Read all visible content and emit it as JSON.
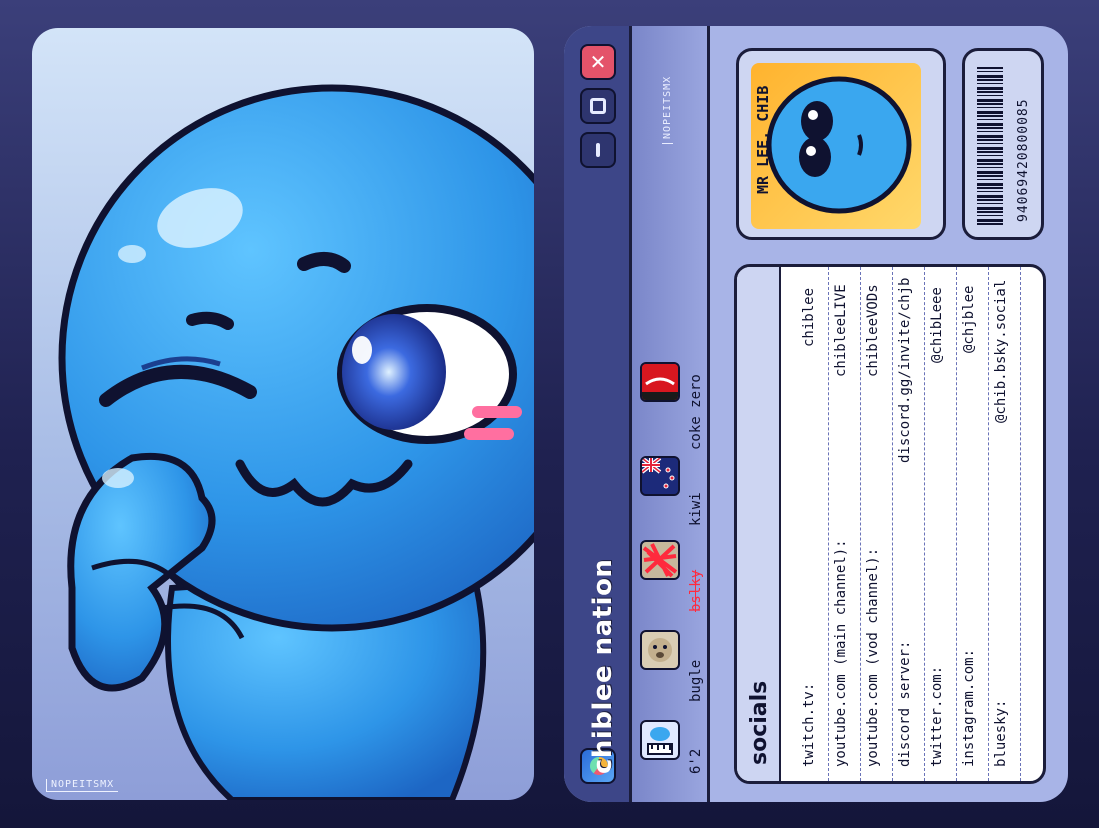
{
  "art": {
    "watermark": "NOPEITSMX"
  },
  "window": {
    "close_label": "✕",
    "app_title": "chiblee nation",
    "watermark": "NOPEITSMX"
  },
  "stats": [
    {
      "icon": "height-ruler-icon",
      "label": "6'2"
    },
    {
      "icon": "bugle-icon",
      "label": "bugle"
    },
    {
      "icon": "crossed-out-icon",
      "label": "bslky"
    },
    {
      "icon": "nz-flag-icon",
      "label": "kiwi"
    },
    {
      "icon": "coke-can-icon",
      "label": "coke zero"
    }
  ],
  "id": {
    "name": "MR LEE, CHIB",
    "barcode_number": "94069420800085"
  },
  "socials": {
    "title": "socials",
    "rows": [
      {
        "key": "twitch.tv:",
        "value": "chiblee"
      },
      {
        "key": "youtube.com (main channel):",
        "value": "chibleeLIVE"
      },
      {
        "key": "youtube.com (vod channel):",
        "value": "chibleeVODs"
      },
      {
        "key": "discord server:",
        "value": "discord.gg/invite/chjb"
      },
      {
        "key": "twitter.com:",
        "value": "@chibLeee"
      },
      {
        "key": "instagram.com:",
        "value": "@chjblee"
      },
      {
        "key": "bluesky:",
        "value": "@chib.bsky.social"
      }
    ]
  },
  "colors": {
    "accent": "#3d4688",
    "character": "#3aa7ef",
    "close": "#e4536a"
  }
}
